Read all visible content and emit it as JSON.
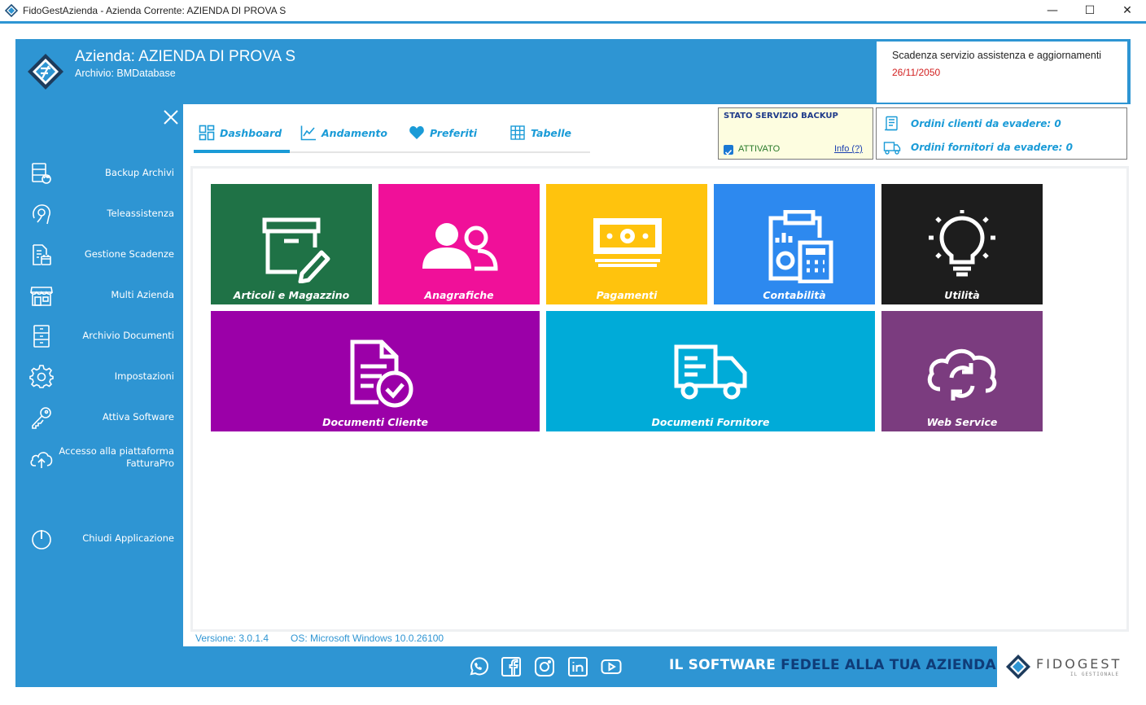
{
  "window": {
    "title": "FidoGestAzienda - Azienda Corrente: AZIENDA DI PROVA S",
    "minimize": "—",
    "maximize": "☐",
    "close": "✕"
  },
  "header": {
    "company": "Azienda: AZIENDA DI PROVA S",
    "archive": "Archivio: BMDatabase"
  },
  "deadline": {
    "label": "Scadenza servizio assistenza e aggiornamenti",
    "date": "26/11/2050",
    "date_color": "#d22020"
  },
  "sidebar": {
    "items": [
      {
        "label": "Backup Archivi",
        "icon": "database-refresh-icon"
      },
      {
        "label": "Teleassistenza",
        "icon": "headset-icon"
      },
      {
        "label": "Gestione Scadenze",
        "icon": "document-calendar-icon"
      },
      {
        "label": "Multi Azienda",
        "icon": "store-icon"
      },
      {
        "label": "Archivio Documenti",
        "icon": "cabinet-icon"
      },
      {
        "label": "Impostazioni",
        "icon": "gear-icon"
      },
      {
        "label": "Attiva Software",
        "icon": "key-icon"
      },
      {
        "label": "Accesso alla piattaforma FatturaPro",
        "icon": "cloud-upload-icon"
      },
      {
        "label": "Chiudi Applicazione",
        "icon": "power-icon"
      }
    ]
  },
  "tabs": [
    {
      "label": "Dashboard",
      "icon": "dashboard-icon",
      "active": true
    },
    {
      "label": "Andamento",
      "icon": "chart-line-icon"
    },
    {
      "label": "Preferiti",
      "icon": "heart-icon"
    },
    {
      "label": "Tabelle",
      "icon": "grid-icon"
    }
  ],
  "backup": {
    "title": "STATO SERVIZIO BACKUP",
    "status": "ATTIVATO",
    "info": "Info (?)"
  },
  "orders": {
    "clients": "Ordini clienti da evadere: 0",
    "suppliers": "Ordini fornitori da evadere: 0"
  },
  "tiles": [
    {
      "label": "Articoli e Magazzino",
      "color": "#1f7246",
      "icon": "archive-box-edit-icon"
    },
    {
      "label": "Anagrafiche",
      "color": "#f01099",
      "icon": "users-icon"
    },
    {
      "label": "Pagamenti",
      "color": "#ffc30d",
      "icon": "banknote-icon"
    },
    {
      "label": "Contabilità",
      "color": "#2d89ef",
      "icon": "clipboard-calculator-icon"
    },
    {
      "label": "Utilità",
      "color": "#1d1d1d",
      "icon": "lightbulb-icon"
    },
    {
      "label": "Documenti Cliente",
      "color": "#9b00a8",
      "icon": "document-check-icon"
    },
    {
      "label": "Documenti Fornitore",
      "color": "#00abd8",
      "icon": "truck-icon"
    },
    {
      "label": "Web Service",
      "color": "#7b3c7f",
      "icon": "cloud-sync-icon"
    }
  ],
  "status": {
    "version": "Versione: 3.0.1.4",
    "os": "OS: Microsoft Windows 10.0.26100"
  },
  "footer": {
    "slogan_a": "IL SOFTWARE ",
    "slogan_b": "FEDELE ALLA TUA AZIENDA",
    "brand": "FIDOGEST",
    "brand_sub": "IL GESTIONALE",
    "social": [
      "whatsapp-icon",
      "facebook-icon",
      "instagram-icon",
      "linkedin-icon",
      "youtube-icon"
    ]
  },
  "colors": {
    "accent": "#2e95d3",
    "tab_text": "#1a9bd7"
  }
}
